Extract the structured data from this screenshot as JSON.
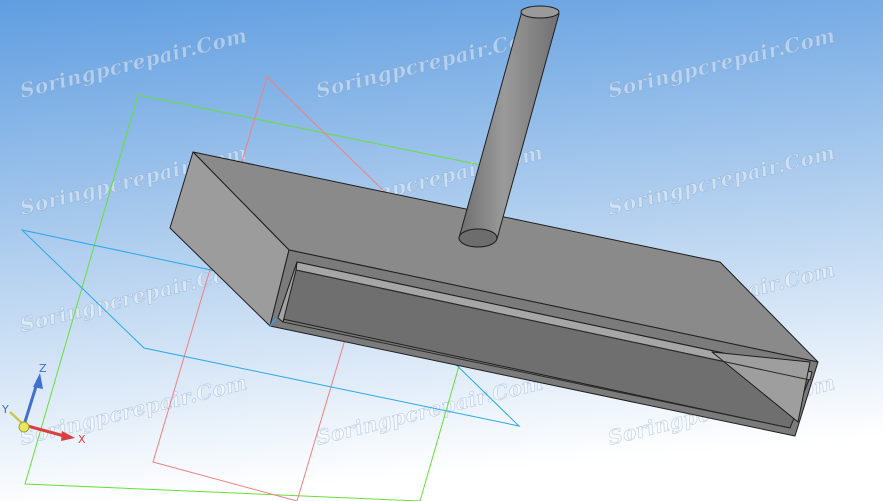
{
  "viewport": {
    "background_top": "#5f9de0",
    "background_bottom": "#ffffff"
  },
  "watermark": {
    "text": "Soringpcrepair.Com",
    "color": "#ffffff"
  },
  "model": {
    "body_color": "#8a8a8a",
    "edge_color": "#1e1e1e",
    "plane_colors": {
      "green": "#66e03a",
      "red": "#f08080",
      "blue": "#2aa8e8"
    }
  },
  "triad": {
    "x_label": "X",
    "y_label": "Y",
    "z_label": "Z",
    "x_color": "#d94040",
    "y_color": "#c8c850",
    "z_color": "#4070d0"
  }
}
